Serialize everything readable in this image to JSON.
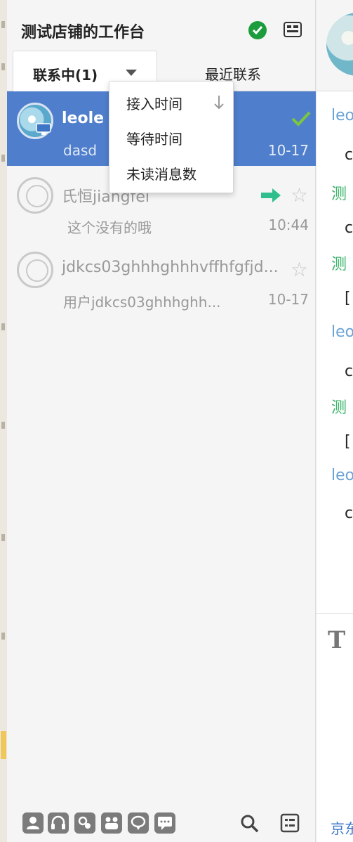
{
  "header": {
    "title": "测试店铺的工作台"
  },
  "tabs": {
    "active": "联系中(1)",
    "recent": "最近联系"
  },
  "dropdown": {
    "items": [
      "接入时间",
      "等待时间",
      "未读消息数"
    ]
  },
  "conversations": [
    {
      "name": "leole",
      "preview": "dasd",
      "time": "10-17"
    },
    {
      "name": "氏恒jiangfei",
      "preview": "这个没有的哦",
      "time": "10:44"
    },
    {
      "name": "jdkcs03ghhhghhhvffhfgfjd...",
      "preview": "用户jdkcs03ghhhghh...",
      "time": "10-17"
    }
  ],
  "chat": {
    "messages": [
      {
        "sender": "leo",
        "body": "c"
      },
      {
        "sender": "测",
        "body": "c"
      },
      {
        "sender": "测",
        "body": "["
      },
      {
        "sender": "leo",
        "body": "c"
      },
      {
        "sender": "测",
        "body": "["
      },
      {
        "sender": "leo",
        "body": "c"
      }
    ],
    "footer_link": "京东"
  },
  "colors": {
    "selected_row": "#4f7fcc",
    "online_green": "#1c9c3c",
    "arrow_green": "#2fbf8c"
  }
}
